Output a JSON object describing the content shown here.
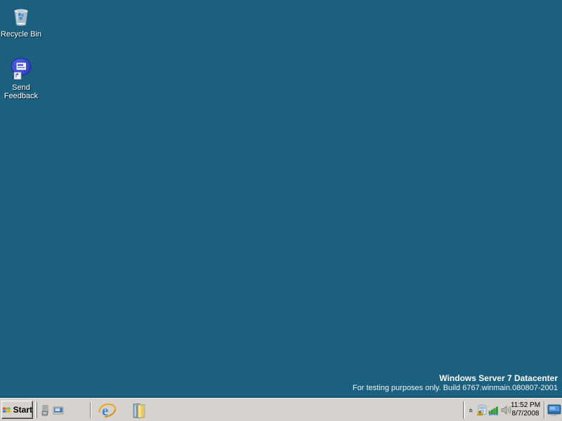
{
  "desktop": {
    "background_color": "#1c607f",
    "icons": [
      {
        "name": "recycle-bin",
        "label": "Recycle Bin"
      },
      {
        "name": "send-feedback",
        "label": "Send Feedback"
      }
    ],
    "watermark": {
      "line1": "Windows Server 7 Datacenter",
      "line2": "For testing purposes only. Build 6767.winmain.080807-2001"
    }
  },
  "taskbar": {
    "start": {
      "label": "Start"
    },
    "quick_launch": [
      {
        "name": "server-manager-icon"
      },
      {
        "name": "show-desktop-icon"
      }
    ],
    "pinned": [
      {
        "name": "internet-explorer-icon"
      },
      {
        "name": "windows-explorer-icon"
      }
    ],
    "tray": {
      "chevron_glyph": "«",
      "icons": [
        {
          "name": "update-warning-icon"
        },
        {
          "name": "network-icon"
        },
        {
          "name": "volume-icon"
        },
        {
          "name": "display-icon"
        }
      ],
      "clock": {
        "time": "11:52 PM",
        "date": "8/7/2008"
      }
    }
  },
  "colors": {
    "desktop_teal": "#1c607f",
    "taskbar_gray": "#d6d3ce",
    "flag_red": "#e4572e",
    "flag_green": "#7cbb3f",
    "flag_blue": "#2f86d6",
    "flag_yellow": "#f2b200",
    "network_green": "#2fae3a",
    "warning_yellow": "#f5c400"
  }
}
